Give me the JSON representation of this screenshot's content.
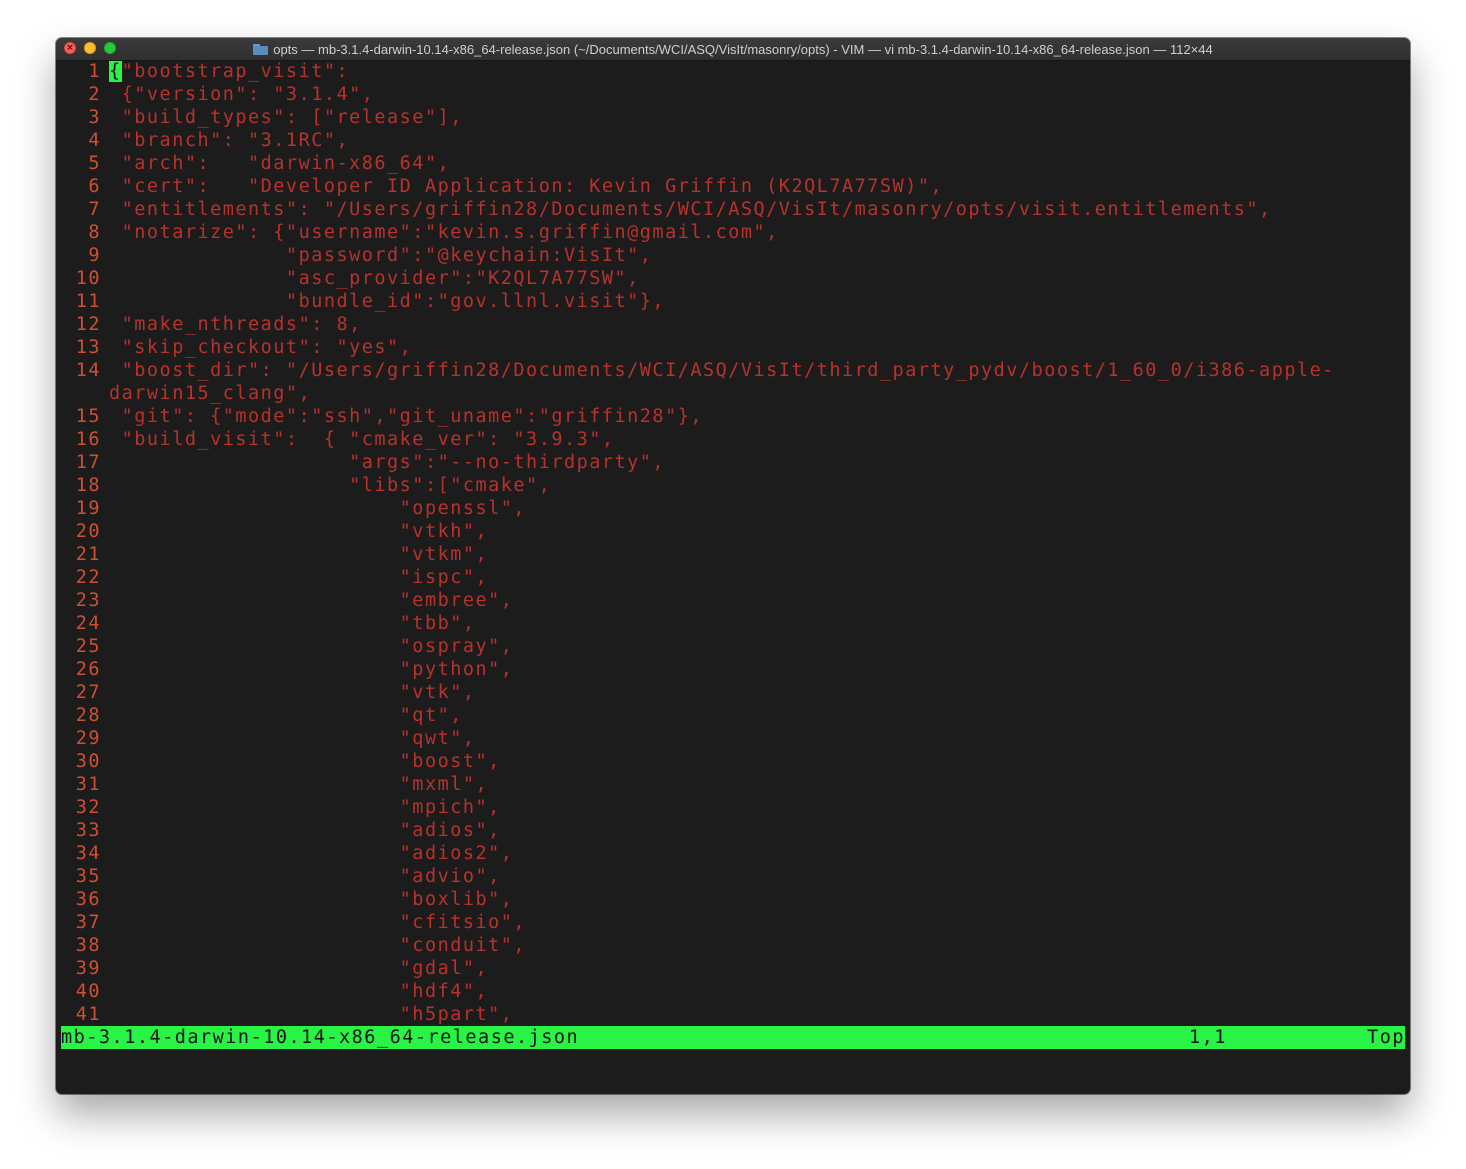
{
  "window": {
    "title": "opts — mb-3.1.4-darwin-10.14-x86_64-release.json (~/Documents/WCI/ASQ/VisIt/masonry/opts) - VIM — vi mb-3.1.4-darwin-10.14-x86_64-release.json — 112×44",
    "close_glyph": "×",
    "title_icon": "folder-icon"
  },
  "editor": {
    "cursor_char": "{",
    "lines": [
      {
        "no": "1",
        "text": "\"bootstrap_visit\":"
      },
      {
        "no": "2",
        "text": " {\"version\": \"3.1.4\","
      },
      {
        "no": "3",
        "text": " \"build_types\": [\"release\"],"
      },
      {
        "no": "4",
        "text": " \"branch\": \"3.1RC\","
      },
      {
        "no": "5",
        "text": " \"arch\":   \"darwin-x86_64\","
      },
      {
        "no": "6",
        "text": " \"cert\":   \"Developer ID Application: Kevin Griffin (K2QL7A77SW)\","
      },
      {
        "no": "7",
        "text": " \"entitlements\": \"/Users/griffin28/Documents/WCI/ASQ/VisIt/masonry/opts/visit.entitlements\","
      },
      {
        "no": "8",
        "text": " \"notarize\": {\"username\":\"kevin.s.griffin@gmail.com\","
      },
      {
        "no": "9",
        "text": "              \"password\":\"@keychain:VisIt\","
      },
      {
        "no": "10",
        "text": "              \"asc_provider\":\"K2QL7A77SW\","
      },
      {
        "no": "11",
        "text": "              \"bundle_id\":\"gov.llnl.visit\"},"
      },
      {
        "no": "12",
        "text": " \"make_nthreads\": 8,"
      },
      {
        "no": "13",
        "text": " \"skip_checkout\": \"yes\","
      },
      {
        "no": "14",
        "text": " \"boost_dir\": \"/Users/griffin28/Documents/WCI/ASQ/VisIt/third_party_pydv/boost/1_60_0/i386-apple-"
      },
      {
        "no": "",
        "text": "darwin15_clang\","
      },
      {
        "no": "15",
        "text": " \"git\": {\"mode\":\"ssh\",\"git_uname\":\"griffin28\"},"
      },
      {
        "no": "16",
        "text": " \"build_visit\":  { \"cmake_ver\": \"3.9.3\","
      },
      {
        "no": "17",
        "text": "                   \"args\":\"--no-thirdparty\","
      },
      {
        "no": "18",
        "text": "                   \"libs\":[\"cmake\","
      },
      {
        "no": "19",
        "text": "                       \"openssl\","
      },
      {
        "no": "20",
        "text": "                       \"vtkh\","
      },
      {
        "no": "21",
        "text": "                       \"vtkm\","
      },
      {
        "no": "22",
        "text": "                       \"ispc\","
      },
      {
        "no": "23",
        "text": "                       \"embree\","
      },
      {
        "no": "24",
        "text": "                       \"tbb\","
      },
      {
        "no": "25",
        "text": "                       \"ospray\","
      },
      {
        "no": "26",
        "text": "                       \"python\","
      },
      {
        "no": "27",
        "text": "                       \"vtk\","
      },
      {
        "no": "28",
        "text": "                       \"qt\","
      },
      {
        "no": "29",
        "text": "                       \"qwt\","
      },
      {
        "no": "30",
        "text": "                       \"boost\","
      },
      {
        "no": "31",
        "text": "                       \"mxml\","
      },
      {
        "no": "32",
        "text": "                       \"mpich\","
      },
      {
        "no": "33",
        "text": "                       \"adios\","
      },
      {
        "no": "34",
        "text": "                       \"adios2\","
      },
      {
        "no": "35",
        "text": "                       \"advio\","
      },
      {
        "no": "36",
        "text": "                       \"boxlib\","
      },
      {
        "no": "37",
        "text": "                       \"cfitsio\","
      },
      {
        "no": "38",
        "text": "                       \"conduit\","
      },
      {
        "no": "39",
        "text": "                       \"gdal\","
      },
      {
        "no": "40",
        "text": "                       \"hdf4\","
      },
      {
        "no": "41",
        "text": "                       \"h5part\","
      }
    ]
  },
  "statusline": {
    "filename": "mb-3.1.4-darwin-10.14-x86_64-release.json",
    "position": "1,1",
    "scroll": "Top"
  },
  "colors": {
    "background": "#1c1c1c",
    "text": "#b8322c",
    "line_numbers": "#cf4f30",
    "statusline": "#29f344",
    "cursor": "#29f344"
  }
}
